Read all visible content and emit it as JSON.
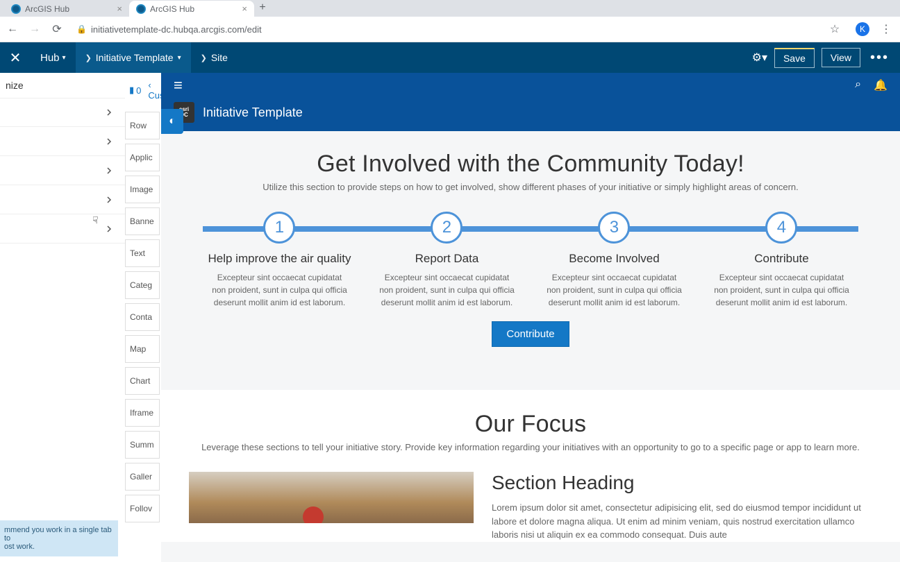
{
  "browser": {
    "tabs": [
      {
        "title": "ArcGIS Hub",
        "active": false
      },
      {
        "title": "ArcGIS Hub",
        "active": true
      }
    ],
    "url": "initiativetemplate-dc.hubqa.arcgis.com/edit",
    "user_badge": "K"
  },
  "appbar": {
    "hub": "Hub",
    "breadcrumb1": "Initiative Template",
    "breadcrumb2": "Site",
    "save": "Save",
    "view": "View"
  },
  "left_panel": {
    "title_fragment": "nize",
    "tip": "mmend you work in a single tab to\nost work."
  },
  "mid_panel": {
    "page_count": "0",
    "customize": "Cust",
    "cards": [
      "Row",
      "Applic",
      "Image",
      "Banne",
      "Text",
      "Categ",
      "Conta",
      "Map",
      "Chart",
      "Iframe",
      "Summ",
      "Galler",
      "Follov"
    ]
  },
  "site": {
    "title": "Initiative Template",
    "logo_top": "esri",
    "logo_bottom": "DC"
  },
  "involved": {
    "heading": "Get Involved with the Community Today!",
    "sub": "Utilize this section to provide steps on how to get involved, show different phases of your initiative or simply highlight areas of concern.",
    "steps": [
      {
        "n": "1",
        "title": "Help improve the air quality",
        "desc": "Excepteur sint occaecat cupidatat non proident, sunt in culpa qui officia deserunt mollit anim id est laborum."
      },
      {
        "n": "2",
        "title": "Report Data",
        "desc": "Excepteur sint occaecat cupidatat non proident, sunt in culpa qui officia deserunt mollit anim id est laborum."
      },
      {
        "n": "3",
        "title": "Become Involved",
        "desc": "Excepteur sint occaecat cupidatat non proident, sunt in culpa qui officia deserunt mollit anim id est laborum."
      },
      {
        "n": "4",
        "title": "Contribute",
        "desc": "Excepteur sint occaecat cupidatat non proident, sunt in culpa qui officia deserunt mollit anim id est laborum."
      }
    ],
    "cta": "Contribute"
  },
  "focus": {
    "heading": "Our Focus",
    "sub": "Leverage these sections to tell your initiative story. Provide key information regarding your initiatives with an opportunity to go to a specific page or app to learn more.",
    "section_title": "Section Heading",
    "section_body": "Lorem ipsum dolor sit amet, consectetur adipisicing elit, sed do eiusmod tempor incididunt ut labore et dolore magna aliqua. Ut enim ad minim veniam, quis nostrud exercitation ullamco laboris nisi ut aliquin ex ea commodo consequat. Duis aute"
  }
}
